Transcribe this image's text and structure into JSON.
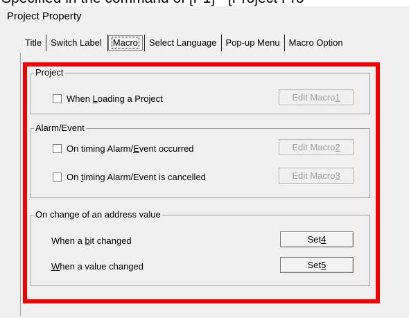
{
  "background_fragment": "Specified in the command of [P1] - [Project Pro",
  "dialog": {
    "title": "Project Property"
  },
  "tabs": [
    "Title",
    "Switch Label",
    "Macro",
    "Select Language",
    "Pop-up Menu",
    "Macro Option"
  ],
  "selected_tab": "Macro",
  "project_group": {
    "title": "Project",
    "items": [
      {
        "label_pre": "When ",
        "label_key": "L",
        "label_post": "oading a Project",
        "checked": false,
        "button": {
          "pre": "Edit Macro",
          "key": "1",
          "enabled": false
        }
      }
    ]
  },
  "alarm_group": {
    "title": "Alarm/Event",
    "items": [
      {
        "label_pre": "On timing Alarm/",
        "label_key": "E",
        "label_post": "vent occurred",
        "checked": false,
        "button": {
          "pre": "Edit Macro",
          "key": "2",
          "enabled": false
        }
      },
      {
        "label_pre": "On ",
        "label_key": "t",
        "label_post": "iming Alarm/Event is cancelled",
        "checked": false,
        "button": {
          "pre": "Edit Macro",
          "key": "3",
          "enabled": false
        }
      }
    ]
  },
  "address_group": {
    "title": "On change of an address value",
    "items": [
      {
        "label_pre": "When a ",
        "label_key": "b",
        "label_post": "it changed",
        "button": {
          "pre": "Set",
          "key": "4",
          "enabled": true
        }
      },
      {
        "label_pre": "",
        "label_key": "W",
        "label_post": "hen a value changed",
        "button": {
          "pre": "Set",
          "key": "5",
          "enabled": true
        }
      }
    ]
  },
  "colors": {
    "highlight_frame": "#f00000",
    "dialog_bg": "#f0f0f0",
    "disabled_text": "#a0a0a0"
  }
}
